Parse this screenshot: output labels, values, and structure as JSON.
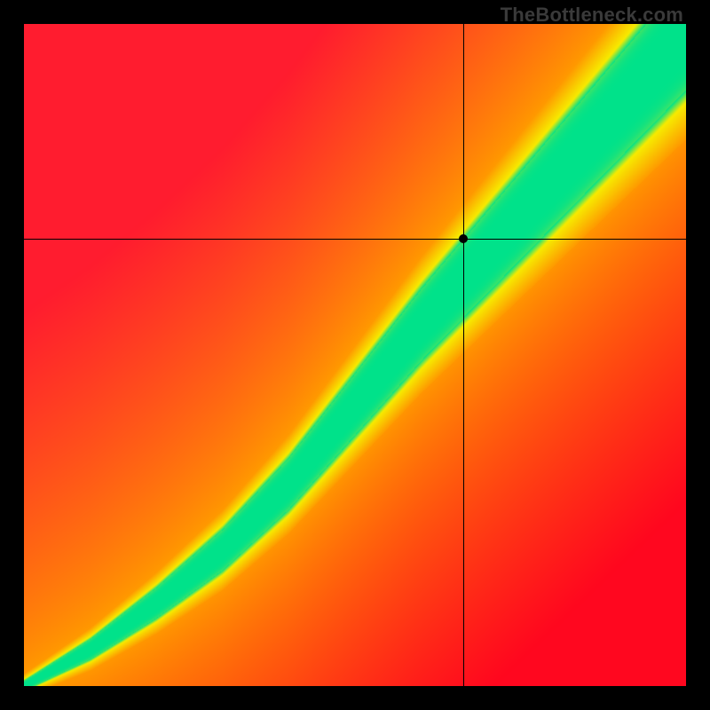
{
  "watermark": "TheBottleneck.com",
  "chart_data": {
    "type": "heatmap",
    "title": "",
    "xlabel": "",
    "ylabel": "",
    "xlim": [
      0,
      1
    ],
    "ylim": [
      0,
      1
    ],
    "marker": {
      "x": 0.665,
      "y": 0.675
    },
    "crosshair": {
      "x": 0.665,
      "y": 0.675
    },
    "ridge": {
      "description": "Green optimal band along a curved diagonal; away from it color transitions through yellow/orange to red",
      "points": [
        {
          "x": 0.0,
          "y": 0.0
        },
        {
          "x": 0.1,
          "y": 0.055
        },
        {
          "x": 0.2,
          "y": 0.125
        },
        {
          "x": 0.3,
          "y": 0.205
        },
        {
          "x": 0.4,
          "y": 0.305
        },
        {
          "x": 0.5,
          "y": 0.425
        },
        {
          "x": 0.6,
          "y": 0.545
        },
        {
          "x": 0.7,
          "y": 0.655
        },
        {
          "x": 0.8,
          "y": 0.765
        },
        {
          "x": 0.9,
          "y": 0.875
        },
        {
          "x": 1.0,
          "y": 0.985
        }
      ],
      "band_halfwidth_start": 0.007,
      "band_halfwidth_end": 0.085,
      "yellow_halfwidth_start": 0.018,
      "yellow_halfwidth_end": 0.16
    },
    "colors": {
      "green": "#00E28B",
      "yellow": "#F7EB00",
      "orange": "#FF9A00",
      "red_top": "#FF1C2F",
      "red_bottom": "#FF071F"
    }
  }
}
